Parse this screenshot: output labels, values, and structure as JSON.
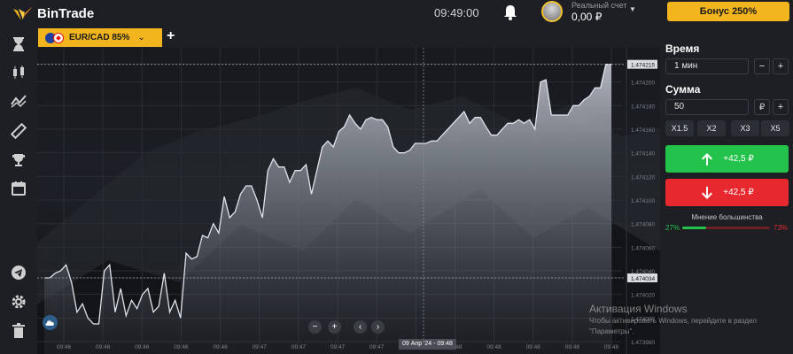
{
  "brand": {
    "name": "BinTrade",
    "accent": "#f2b51e"
  },
  "header": {
    "time": "09:49:00",
    "account_label": "Реальный счет",
    "balance": "0,00 ₽",
    "bonus_label": "Бонус 250%"
  },
  "sidebar": {
    "icons": [
      "hourglass-icon",
      "candles-icon",
      "indicators-icon",
      "ruler-icon",
      "trophy-icon",
      "calendar-icon",
      "telegram-icon",
      "settings-icon",
      "trash-icon"
    ]
  },
  "tabs": {
    "asset_label": "EUR/CAD 85%",
    "add_label": "+"
  },
  "chart_data": {
    "type": "area",
    "title": "",
    "xlabel": "",
    "ylabel": "",
    "ylim": [
      1.47398,
      1.47422
    ],
    "y_ticks": [
      "1.474215",
      "1.474200",
      "1.474180",
      "1.474160",
      "1.474140",
      "1.474120",
      "1.474100",
      "1.474080",
      "1.474060",
      "1.474040",
      "1.474034",
      "1.474020",
      "1.474000",
      "1.473980"
    ],
    "x_ticks": [
      "09:46",
      "09:46",
      "09:46",
      "09:46",
      "09:46",
      "09:47",
      "09:47",
      "09:47",
      "09:47",
      "09:47",
      "09:48",
      "09:48",
      "09:48",
      "09:48",
      "09:48"
    ],
    "series": [
      {
        "values": [
          1.474034,
          1.474034,
          1.474038,
          1.47404,
          1.474045,
          1.47403,
          1.474005,
          1.474012,
          1.474,
          1.473995,
          1.473995,
          1.47404,
          1.474045,
          1.474005,
          1.474025,
          1.474002,
          1.474015,
          1.474008,
          1.47402,
          1.474025,
          1.474005,
          1.47401,
          1.474038,
          1.474005,
          1.474015,
          1.474,
          1.474055,
          1.47405,
          1.474052,
          1.47407,
          1.474068,
          1.47408,
          1.474072,
          1.474103,
          1.474085,
          1.47409,
          1.474105,
          1.474112,
          1.474112,
          1.4741,
          1.474085,
          1.474125,
          1.474135,
          1.474128,
          1.474128,
          1.474115,
          1.474125,
          1.474125,
          1.47413,
          1.474105,
          1.474125,
          1.474145,
          1.47415,
          1.474145,
          1.474158,
          1.474162,
          1.474172,
          1.474165,
          1.47416,
          1.474168,
          1.47417,
          1.474168,
          1.474168,
          1.474162,
          1.474145,
          1.47414,
          1.47414,
          1.474142,
          1.474148,
          1.474148,
          1.474148,
          1.47415,
          1.47415,
          1.474155,
          1.47416,
          1.474165,
          1.47417,
          1.474175,
          1.474165,
          1.47417,
          1.47417,
          1.474162,
          1.474155,
          1.474155,
          1.47416,
          1.474165,
          1.474165,
          1.474168,
          1.474165,
          1.474168,
          1.47416,
          1.4742,
          1.474202,
          1.474172,
          1.474172,
          1.474172,
          1.474172,
          1.47418,
          1.47418,
          1.474185,
          1.474188,
          1.474195,
          1.474195,
          1.474215,
          1.474215
        ]
      }
    ],
    "current_price": "1.474215",
    "reference_price": "1.474034",
    "crosshair_time": "09 Апр '24 - 09:48",
    "grid": true
  },
  "chart_controls": {
    "zoom_out": "−",
    "zoom_in": "+",
    "back": "‹",
    "forward": "›"
  },
  "panel": {
    "time_label": "Время",
    "time_value": "1 мин",
    "amount_label": "Сумма",
    "amount_value": "50",
    "currency": "₽",
    "multipliers": [
      "X1.5",
      "X2",
      "X3",
      "X5"
    ],
    "up_payout": "+42,5 ₽",
    "down_payout": "+42,5 ₽",
    "majority_label": "Мнение большинства",
    "majority_up": "27%",
    "majority_down": "73%",
    "majority_up_fraction": 0.27,
    "up_color": "#23c24b",
    "down_color": "#e8282f"
  },
  "watermark": {
    "line1": "Активация Windows",
    "line2": "Чтобы активировать Windows, перейдите в раздел",
    "line3": "\"Параметры\"."
  }
}
